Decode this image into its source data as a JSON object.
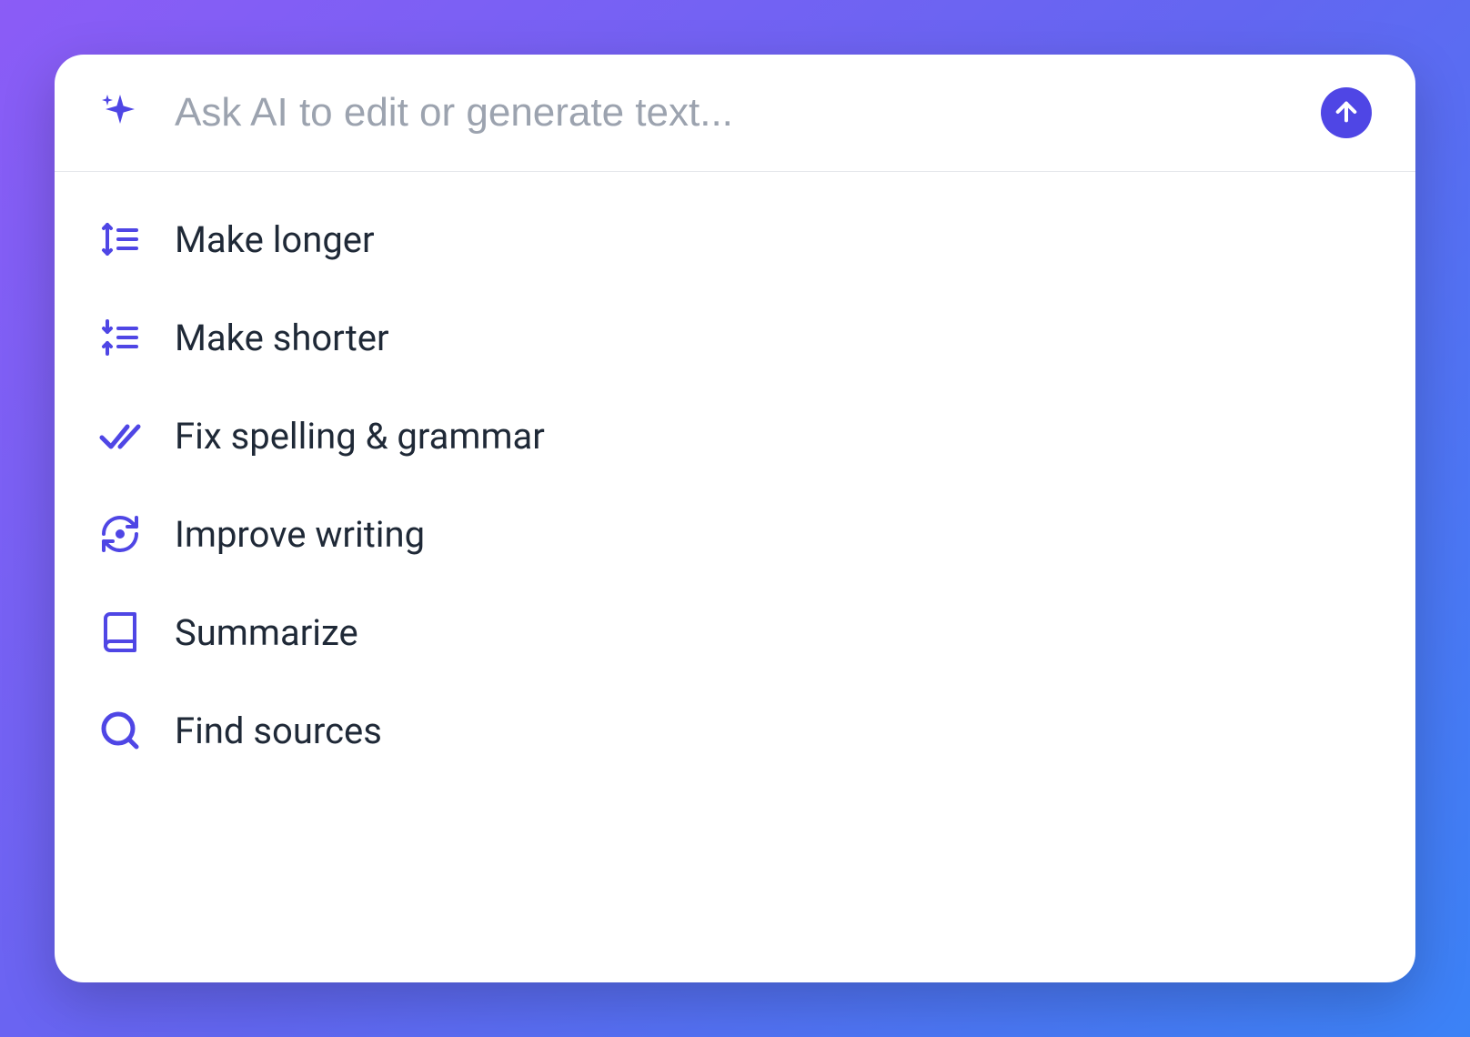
{
  "input": {
    "placeholder": "Ask AI to edit or generate text...",
    "value": ""
  },
  "menu": {
    "items": [
      {
        "icon": "expand-lines-icon",
        "label": "Make longer"
      },
      {
        "icon": "compress-lines-icon",
        "label": "Make shorter"
      },
      {
        "icon": "double-check-icon",
        "label": "Fix spelling & grammar"
      },
      {
        "icon": "refresh-icon",
        "label": "Improve writing"
      },
      {
        "icon": "book-icon",
        "label": "Summarize"
      },
      {
        "icon": "search-icon",
        "label": "Find sources"
      }
    ]
  },
  "colors": {
    "accent": "#4f46e5",
    "text": "#1f2937",
    "placeholder": "#9ca3af"
  }
}
